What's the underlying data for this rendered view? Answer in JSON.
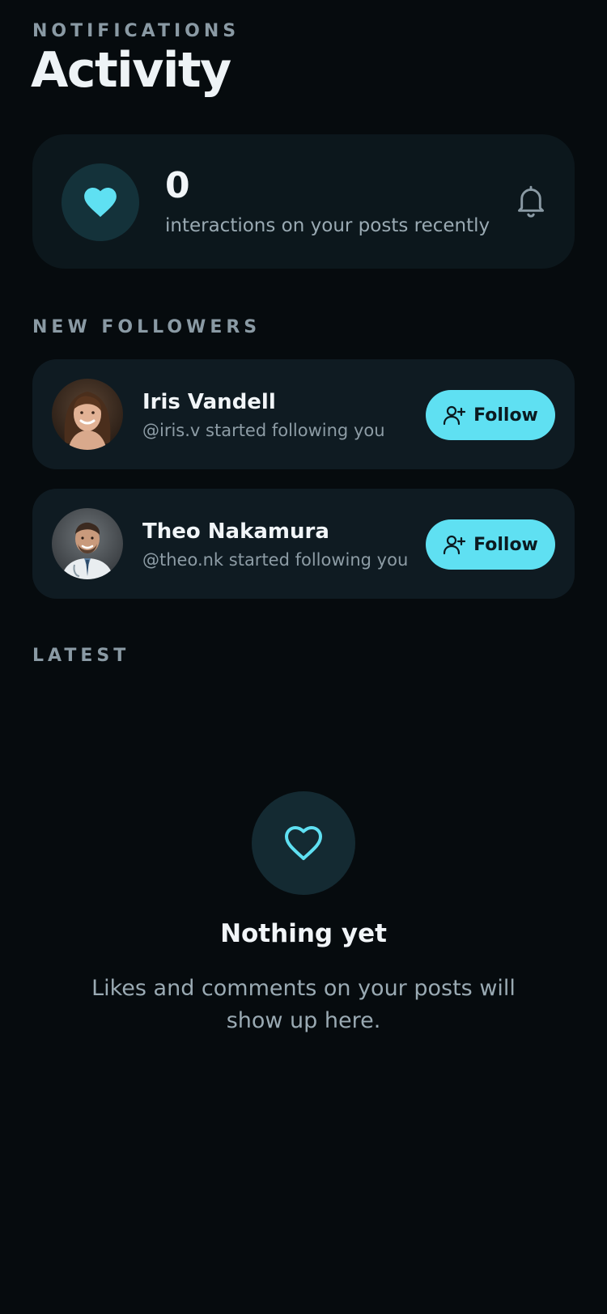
{
  "header": {
    "eyebrow": "NOTIFICATIONS",
    "title": "Activity"
  },
  "summary": {
    "count": "0",
    "text": "interactions on your posts recently",
    "icon": "heart-filled-icon",
    "bell_icon": "bell-icon"
  },
  "new_followers": {
    "heading": "NEW FOLLOWERS",
    "items": [
      {
        "name": "Iris Vandell",
        "subtitle": "@iris.v started following you",
        "button": "Follow",
        "avatar": "woman-portrait"
      },
      {
        "name": "Theo Nakamura",
        "subtitle": "@theo.nk started following you",
        "button": "Follow",
        "avatar": "man-portrait"
      }
    ]
  },
  "latest": {
    "heading": "LATEST",
    "empty_title": "Nothing yet",
    "empty_text": "Likes and comments on your posts will show up here.",
    "empty_icon": "heart-outline-icon"
  },
  "colors": {
    "background": "#060b0e",
    "card": "#0f1b22",
    "accent": "#5fe0f2",
    "muted": "#8a9aa4"
  }
}
